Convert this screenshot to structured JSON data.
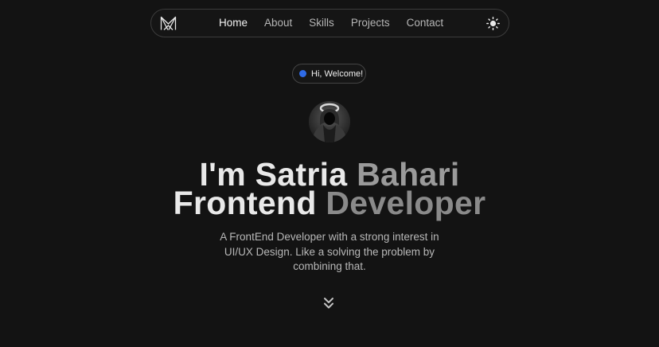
{
  "navbar": {
    "logo_icon": "m-monogram-logo-icon",
    "links": [
      {
        "label": "Home",
        "active": true
      },
      {
        "label": "About",
        "active": false
      },
      {
        "label": "Skills",
        "active": false
      },
      {
        "label": "Projects",
        "active": false
      },
      {
        "label": "Contact",
        "active": false
      }
    ],
    "theme_toggle_icon": "sun-icon"
  },
  "badge": {
    "text": "Hi, Welcome!",
    "dot_color": "#2f6be6"
  },
  "avatar": {
    "icon": "hooded-figure-avatar"
  },
  "hero": {
    "line1": {
      "part1": "I'm Satria",
      "part2": "Bahari"
    },
    "line2": {
      "part1": "Frontend",
      "part2": "Developer"
    }
  },
  "description": {
    "line1": "A FrontEnd Developer with a strong interest in",
    "line2": "UI/UX Design. Like a solving the problem by",
    "line3": "combining that."
  },
  "scroll": {
    "icon": "double-chevron-down-icon"
  },
  "colors": {
    "background": "#131313",
    "accent": "#2f6be6",
    "text_bright": "#e9e9e9",
    "text_dim": "#9a9a9a"
  }
}
